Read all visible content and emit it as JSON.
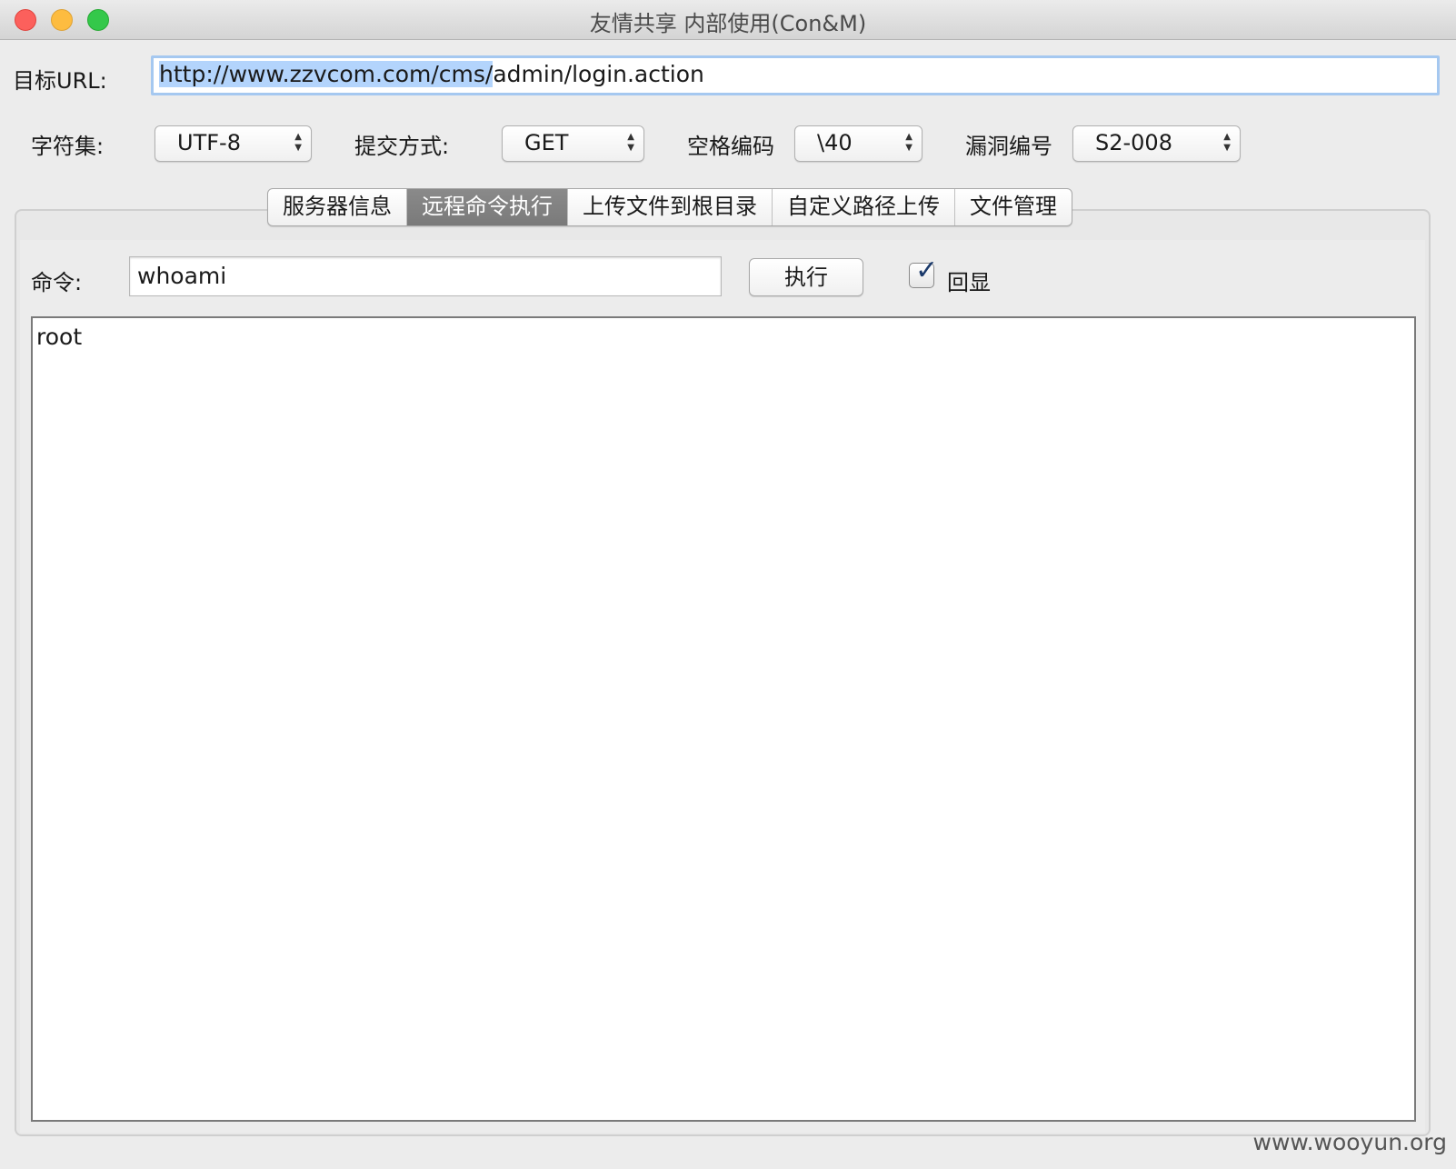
{
  "window": {
    "title": "友情共享 内部使用(Con&M)"
  },
  "url": {
    "label": "目标URL:",
    "value_selected": "http://www.zzvcom.com/cms/",
    "value_rest": "admin/login.action"
  },
  "options": {
    "charset": {
      "label": "字符集:",
      "value": "UTF-8"
    },
    "method": {
      "label": "提交方式:",
      "value": "GET"
    },
    "space_encoding": {
      "label": "空格编码",
      "value": "\\40"
    },
    "vuln_id": {
      "label": "漏洞编号",
      "value": "S2-008"
    }
  },
  "tabs": [
    {
      "label": "服务器信息",
      "active": false
    },
    {
      "label": "远程命令执行",
      "active": true
    },
    {
      "label": "上传文件到根目录",
      "active": false
    },
    {
      "label": "自定义路径上传",
      "active": false
    },
    {
      "label": "文件管理",
      "active": false
    }
  ],
  "command": {
    "label": "命令:",
    "value": "whoami",
    "execute_label": "执行",
    "echo_label": "回显",
    "echo_checked": true
  },
  "output": {
    "text": "root"
  },
  "watermark": "www.wooyun.org"
}
